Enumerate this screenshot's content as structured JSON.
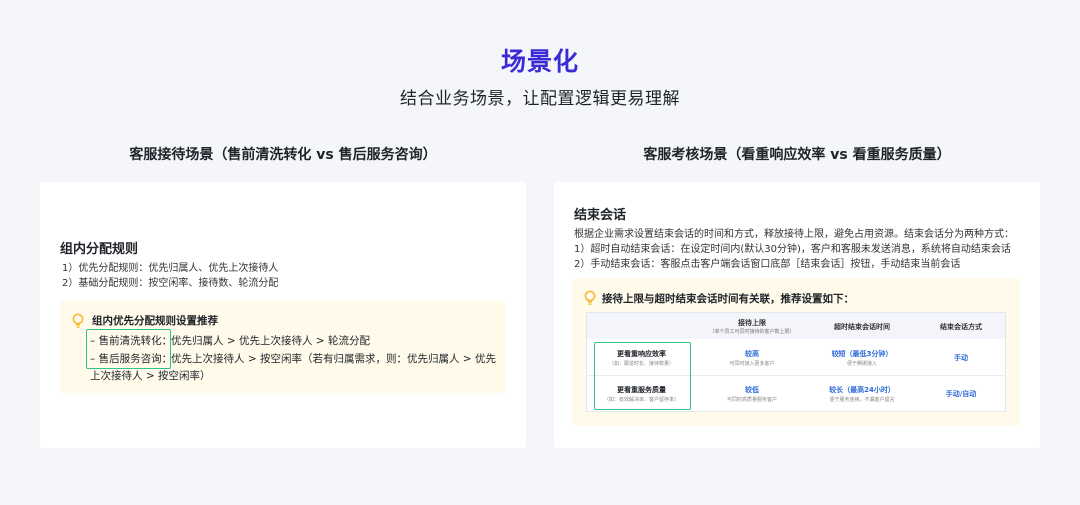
{
  "header": {
    "title": "场景化",
    "subtitle": "结合业务场景，让配置逻辑更易理解"
  },
  "left": {
    "card_title": "客服接待场景（售前清洗转化 vs 售后服务咨询）",
    "section_title": "组内分配规则",
    "rules": [
      "1）优先分配规则：优先归属人、优先上次接待人",
      "2）基础分配规则：按空闲率、接待数、轮流分配"
    ],
    "tip": {
      "title": "组内优先分配规则设置推荐",
      "line1_label": "– 售前清洗转化：",
      "line1_text": "优先归属人 > 优先上次接待人 > 轮流分配",
      "line2_label": "– 售后服务咨询：",
      "line2_text": "优先上次接待人 > 按空闲率（若有归属需求，则：优先归属人 > 优先",
      "line3_text": "上次接待人 > 按空闲率）"
    }
  },
  "right": {
    "card_title": "客服考核场景（看重响应效率 vs 看重服务质量）",
    "section_title": "结束会话",
    "desc": [
      "根据企业需求设置结束会话的时间和方式，释放接待上限，避免占用资源。结束会话分为两种方式：",
      "1）超时自动结束会话：在设定时间内(默认30分钟)，客户和客服未发送消息，系统将自动结束会话",
      "2）手动结束会话：客服点击客户端会话窗口底部［结束会话］按钮，手动结束当前会话"
    ],
    "tip_title": "接待上限与超时结束会话时间有关联，推荐设置如下：",
    "table": {
      "headers": [
        {
          "title": "接待上限",
          "sub": "（单个员工可同时接待的客户数上限）"
        },
        {
          "title": "超时结束会话时间",
          "sub": ""
        },
        {
          "title": "结束会话方式",
          "sub": ""
        }
      ],
      "rows": [
        {
          "label": "更看重响应效率",
          "label_sub": "（如：跟进时长、接待数量）",
          "limit": "较高",
          "limit_sub": "可同时接入更多客户",
          "timeout": "较短（最低3分钟）",
          "timeout_sub": "便于腾挪接入",
          "method": "手动"
        },
        {
          "label": "更看重服务质量",
          "label_sub": "（如：有效解决率、客户留存率）",
          "limit": "较低",
          "limit_sub": "可同时高质量服务客户",
          "timeout": "较长（最高24小时）",
          "timeout_sub": "便于服务连续，不漏客户留言",
          "method": "手动/自动"
        }
      ]
    }
  },
  "colors": {
    "accent": "#3a2bd6",
    "highlight": "#2ec38a",
    "link_blue": "#2f6bd8",
    "tip_bg": "#fffaea",
    "bulb": "#f6b93b"
  }
}
